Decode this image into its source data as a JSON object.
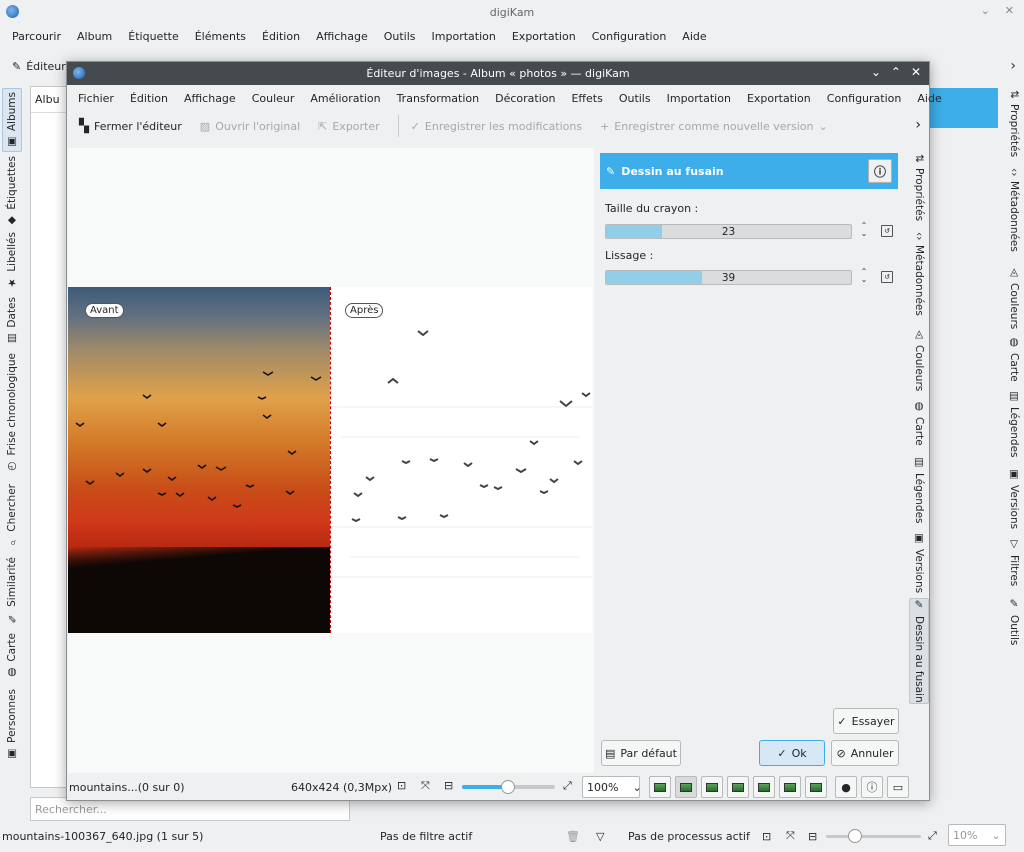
{
  "main": {
    "title": "digiKam",
    "menu": [
      "Parcourir",
      "Album",
      "Étiquette",
      "Éléments",
      "Édition",
      "Affichage",
      "Outils",
      "Importation",
      "Exportation",
      "Configuration",
      "Aide"
    ],
    "toolbar_edit": "Éditeur",
    "album_header": "Albu",
    "left_tabs": [
      "Albums",
      "Étiquettes",
      "Libellés",
      "Dates",
      "Frise chronologique",
      "Chercher",
      "Similarité",
      "Carte",
      "Personnes"
    ],
    "right_tabs": [
      "Propriétés",
      "Métadonnées",
      "Couleurs",
      "Carte",
      "Légendes",
      "Versions",
      "Filtres",
      "Outils"
    ],
    "search_placeholder": "Rechercher...",
    "status_file": "mountains-100367_640.jpg (1 sur 5)",
    "status_filter": "Pas de filtre actif",
    "status_process": "Pas de processus actif",
    "zoom": "10%"
  },
  "editor": {
    "title": "Éditeur d'images - Album « photos » — digiKam",
    "menu": [
      "Fichier",
      "Édition",
      "Affichage",
      "Couleur",
      "Amélioration",
      "Transformation",
      "Décoration",
      "Effets",
      "Outils",
      "Importation",
      "Exportation",
      "Configuration",
      "Aide"
    ],
    "toolbar": {
      "close": "Fermer l'éditeur",
      "open_original": "Ouvrir l'original",
      "export": "Exporter",
      "save_changes": "Enregistrer les modifications",
      "save_new_version": "Enregistrer comme nouvelle version"
    },
    "preview": {
      "before": "Avant",
      "after": "Après"
    },
    "tool": {
      "name": "Dessin au fusain",
      "pencil_label": "Taille du crayon :",
      "pencil_value": "23",
      "pencil_fraction": 0.23,
      "smooth_label": "Lissage :",
      "smooth_value": "39",
      "smooth_fraction": 0.39,
      "try": "Essayer",
      "default": "Par défaut",
      "ok": "Ok",
      "cancel": "Annuler"
    },
    "right_tabs": [
      "Propriétés",
      "Métadonnées",
      "Couleurs",
      "Carte",
      "Légendes",
      "Versions",
      "Dessin au fusain"
    ],
    "status": {
      "file": "mountains...(0 sur 0)",
      "size": "640x424 (0,3Mpx)",
      "zoom": "100%"
    }
  },
  "colors": {
    "accent": "#3daee9",
    "title_bar": "#454a4f",
    "slider_fill": "#93cee9"
  }
}
